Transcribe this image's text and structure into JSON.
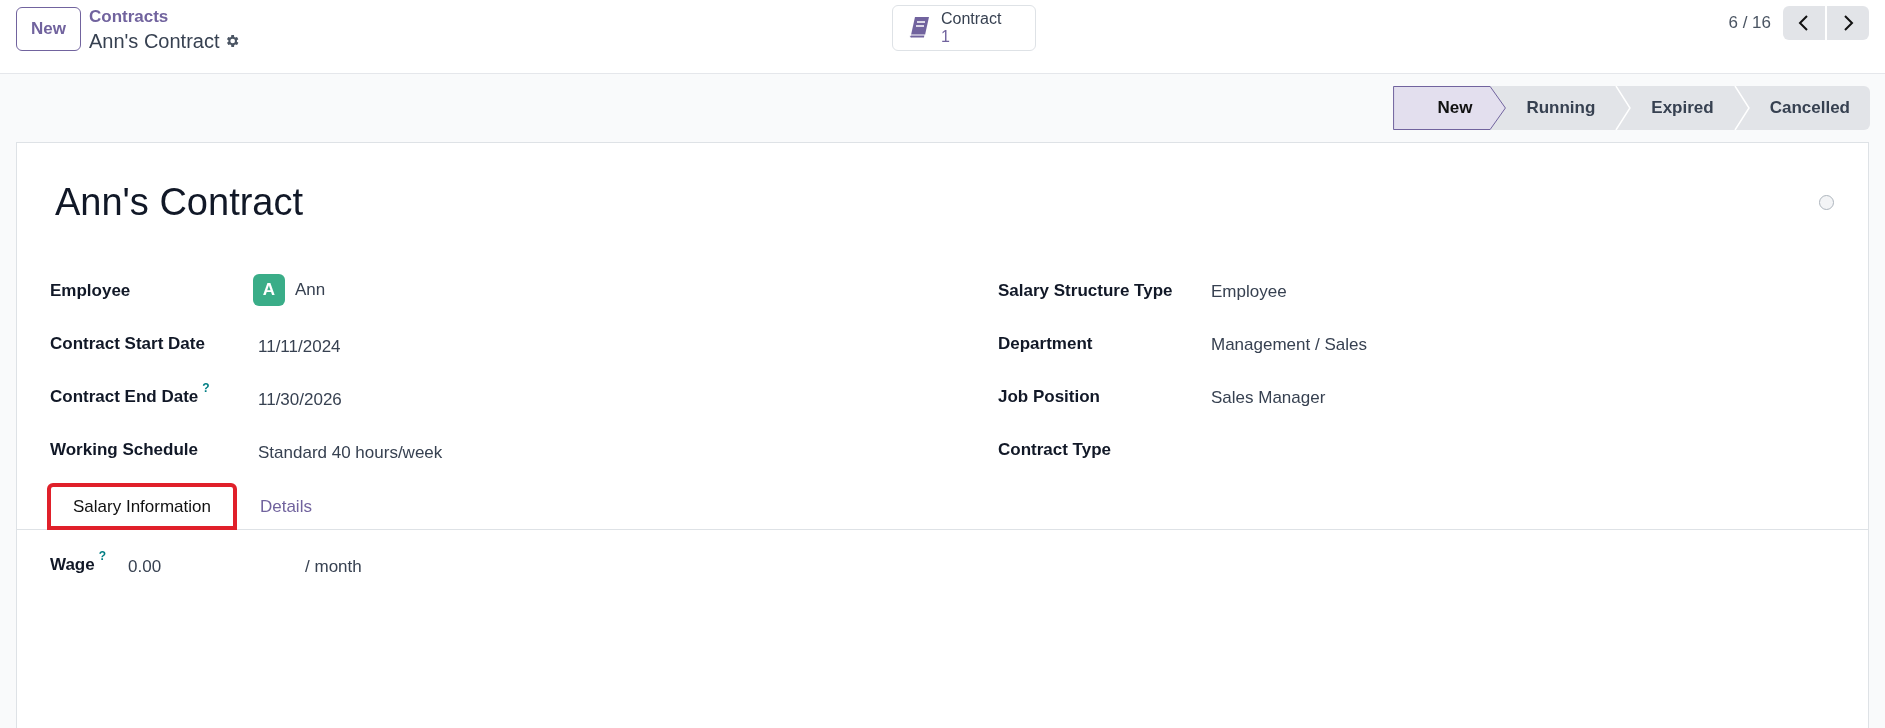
{
  "control_panel": {
    "new_button": "New",
    "breadcrumb": {
      "parent": "Contracts",
      "current": "Ann's Contract"
    },
    "smart_button": {
      "label": "Contract",
      "count": "1"
    },
    "pager": "6 / 16"
  },
  "statusbar": [
    {
      "label": "New",
      "selected": true
    },
    {
      "label": "Running",
      "selected": false
    },
    {
      "label": "Expired",
      "selected": false
    },
    {
      "label": "Cancelled",
      "selected": false
    }
  ],
  "form": {
    "title": "Ann's Contract",
    "left_fields": [
      {
        "label": "Employee",
        "kind": "avatar",
        "initial": "A",
        "value": "Ann"
      },
      {
        "label": "Contract Start Date",
        "kind": "text",
        "value": "11/11/2024"
      },
      {
        "label": "Contract End Date",
        "help_mark": "?",
        "kind": "text",
        "value": "11/30/2026"
      },
      {
        "label": "Working Schedule",
        "kind": "text",
        "value": "Standard 40 hours/week"
      }
    ],
    "right_fields": [
      {
        "label": "Salary Structure Type",
        "value": "Employee"
      },
      {
        "label": "Department",
        "value": "Management / Sales"
      },
      {
        "label": "Job Position",
        "value": "Sales Manager"
      },
      {
        "label": "Contract Type"
      }
    ],
    "tabs": [
      {
        "label": "Salary Information",
        "selected": true,
        "highlighted": true
      },
      {
        "label": "Details",
        "selected": false,
        "highlighted": false
      }
    ],
    "wage": {
      "label": "Wage",
      "help_mark": "?",
      "value": "0.00",
      "unit": "/ month"
    }
  }
}
